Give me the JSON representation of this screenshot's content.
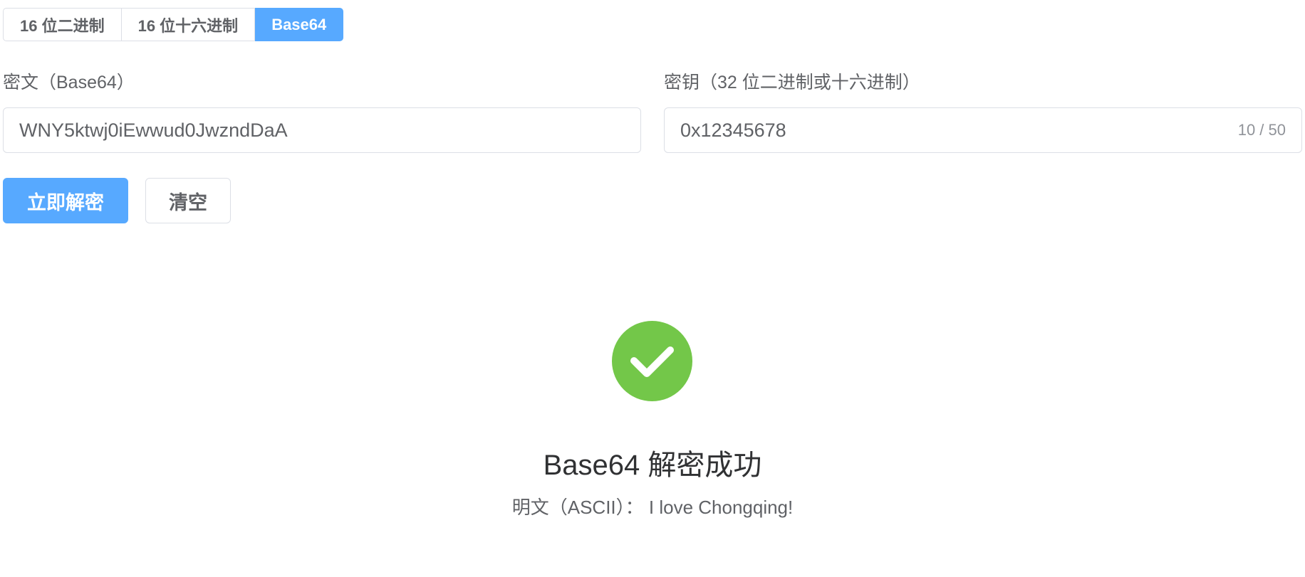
{
  "tabs": [
    {
      "label": "16 位二进制",
      "active": false
    },
    {
      "label": "16 位十六进制",
      "active": false
    },
    {
      "label": "Base64",
      "active": true
    }
  ],
  "form": {
    "cipher": {
      "label": "密文（Base64）",
      "value": "WNY5ktwj0iEwwud0JwzndDaA"
    },
    "key": {
      "label": "密钥（32 位二进制或十六进制）",
      "value": "0x12345678",
      "counter": "10 / 50"
    }
  },
  "buttons": {
    "decrypt": "立即解密",
    "clear": "清空"
  },
  "result": {
    "icon": "check-circle-icon",
    "status_color": "#67c23a",
    "title": "Base64 解密成功",
    "subtitle": "明文（ASCII）： I love Chongqing!"
  },
  "colors": {
    "primary": "#409eff",
    "success": "#67c23a",
    "border": "#dcdfe6"
  }
}
